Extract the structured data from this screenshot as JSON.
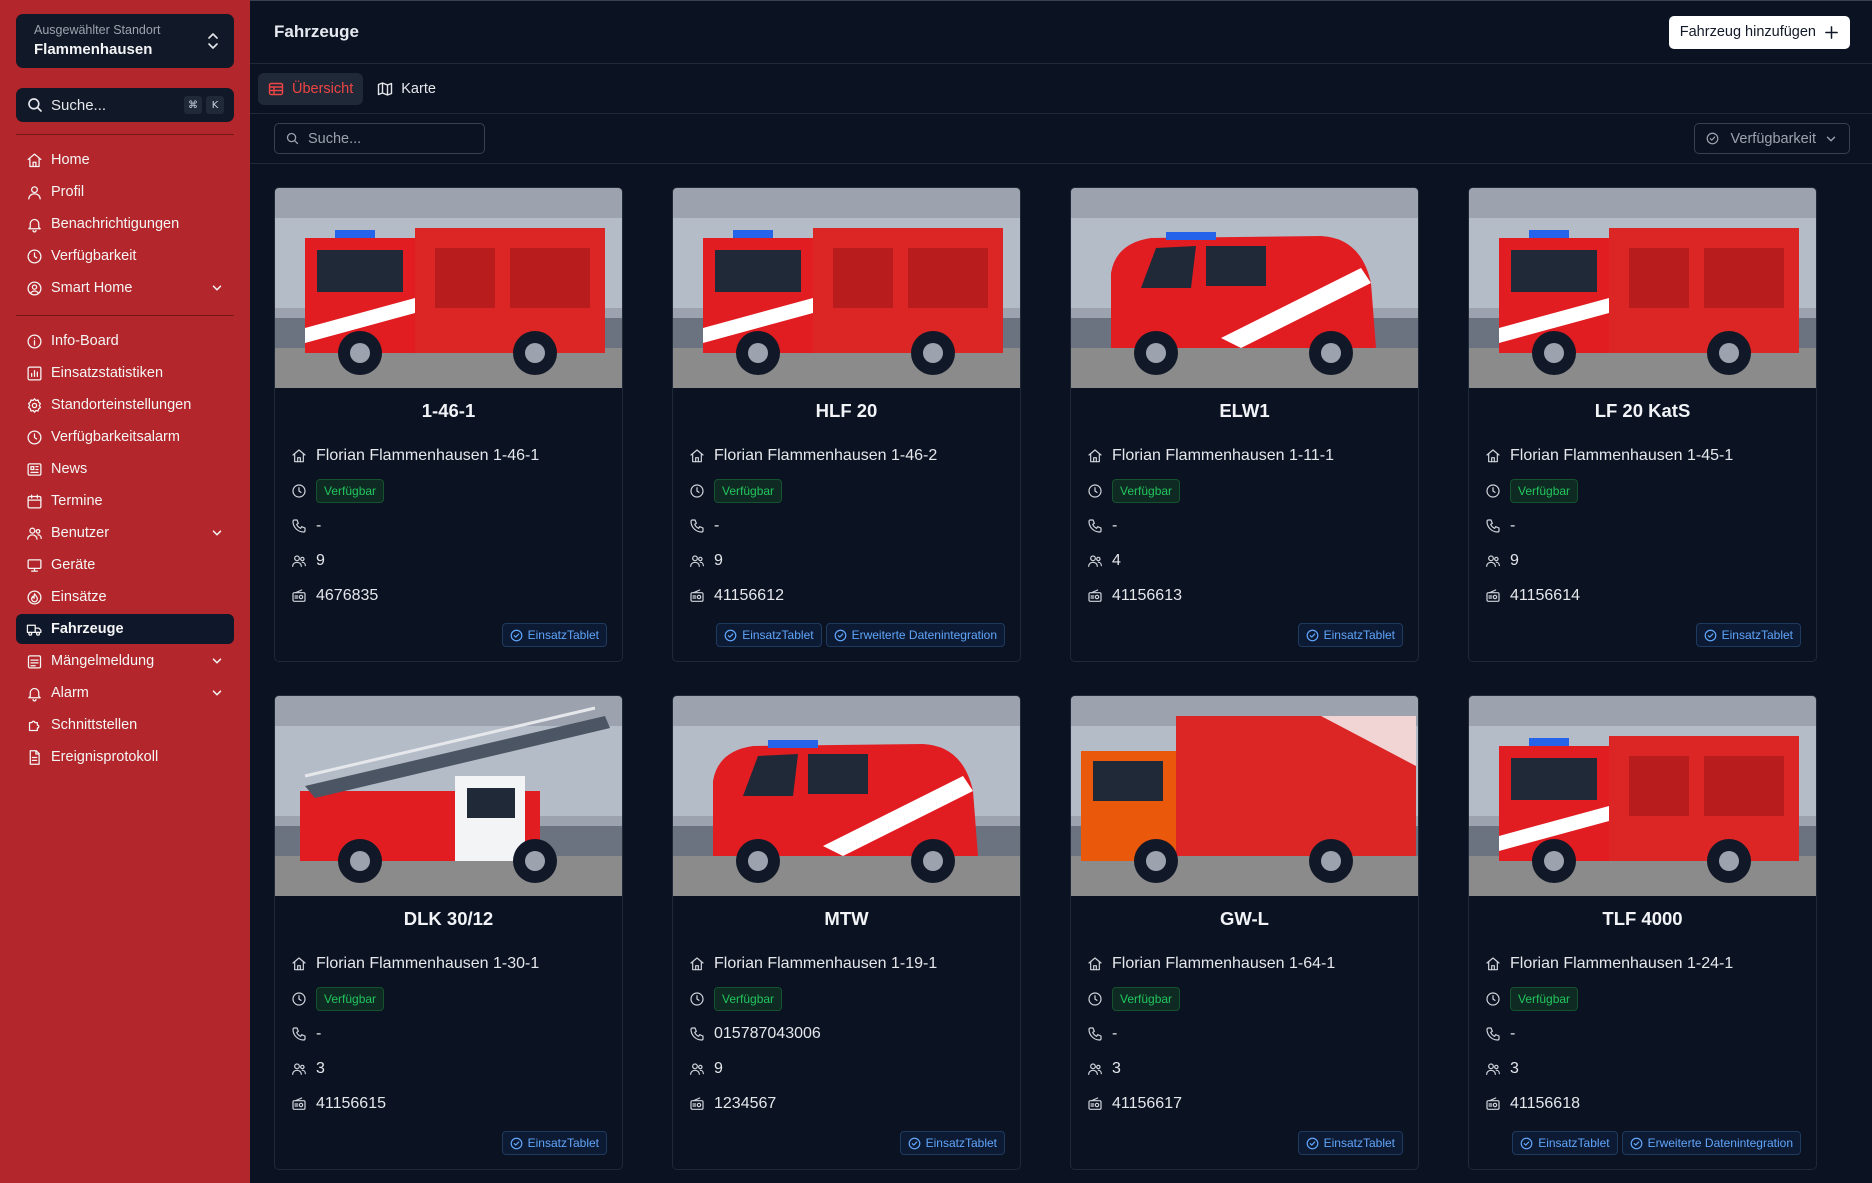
{
  "sidebar": {
    "location_label": "Ausgewählter Standort",
    "location_value": "Flammenhausen",
    "search_placeholder": "Suche...",
    "shortcut_keys": [
      "⌘",
      "K"
    ],
    "items_top": [
      {
        "label": "Home",
        "icon": "home-icon"
      },
      {
        "label": "Profil",
        "icon": "user-icon"
      },
      {
        "label": "Benachrichtigungen",
        "icon": "bell-icon"
      },
      {
        "label": "Verfügbarkeit",
        "icon": "clock-icon"
      },
      {
        "label": "Smart Home",
        "icon": "user-circle-icon",
        "expandable": true
      }
    ],
    "items_bottom": [
      {
        "label": "Info-Board",
        "icon": "info-icon"
      },
      {
        "label": "Einsatzstatistiken",
        "icon": "chart-icon"
      },
      {
        "label": "Standorteinstellungen",
        "icon": "gear-icon"
      },
      {
        "label": "Verfügbarkeitsalarm",
        "icon": "clock-icon"
      },
      {
        "label": "News",
        "icon": "newspaper-icon"
      },
      {
        "label": "Termine",
        "icon": "calendar-icon"
      },
      {
        "label": "Benutzer",
        "icon": "users-icon",
        "expandable": true
      },
      {
        "label": "Geräte",
        "icon": "monitor-icon"
      },
      {
        "label": "Einsätze",
        "icon": "flame-icon"
      },
      {
        "label": "Fahrzeuge",
        "icon": "truck-icon",
        "active": true
      },
      {
        "label": "Mängelmeldung",
        "icon": "clipboard-icon",
        "expandable": true
      },
      {
        "label": "Alarm",
        "icon": "bell-icon",
        "expandable": true
      },
      {
        "label": "Schnittstellen",
        "icon": "puzzle-icon"
      },
      {
        "label": "Ereignisprotokoll",
        "icon": "file-icon"
      }
    ]
  },
  "header": {
    "title": "Fahrzeuge",
    "add_button": "Fahrzeug hinzufügen"
  },
  "tabs": [
    {
      "label": "Übersicht",
      "active": true,
      "icon": "table-icon"
    },
    {
      "label": "Karte",
      "active": false,
      "icon": "map-icon"
    }
  ],
  "filters": {
    "search_placeholder": "Suche...",
    "availability_label": "Verfügbarkeit"
  },
  "colors": {
    "sidebar": "#b3262b",
    "background": "#0b1222",
    "status_green": "#22c55e",
    "badge_blue": "#60a5fa",
    "active_tab": "#ef4444"
  },
  "vehicles": [
    {
      "name": "1-46-1",
      "radio_name": "Florian Flammenhausen 1-46-1",
      "status": "Verfügbar",
      "phone": "-",
      "crew": "9",
      "issi": "4676835",
      "badges": [
        "EinsatzTablet"
      ],
      "style": "box"
    },
    {
      "name": "HLF 20",
      "radio_name": "Florian Flammenhausen 1-46-2",
      "status": "Verfügbar",
      "phone": "-",
      "crew": "9",
      "issi": "41156612",
      "badges": [
        "EinsatzTablet",
        "Erweiterte Datenintegration"
      ],
      "style": "box"
    },
    {
      "name": "ELW1",
      "radio_name": "Florian Flammenhausen 1-11-1",
      "status": "Verfügbar",
      "phone": "-",
      "crew": "4",
      "issi": "41156613",
      "badges": [
        "EinsatzTablet"
      ],
      "style": "van"
    },
    {
      "name": "LF 20 KatS",
      "radio_name": "Florian Flammenhausen 1-45-1",
      "status": "Verfügbar",
      "phone": "-",
      "crew": "9",
      "issi": "41156614",
      "badges": [
        "EinsatzTablet"
      ],
      "style": "box"
    },
    {
      "name": "DLK 30/12",
      "radio_name": "Florian Flammenhausen 1-30-1",
      "status": "Verfügbar",
      "phone": "-",
      "crew": "3",
      "issi": "41156615",
      "badges": [
        "EinsatzTablet"
      ],
      "style": "ladder"
    },
    {
      "name": "MTW",
      "radio_name": "Florian Flammenhausen 1-19-1",
      "status": "Verfügbar",
      "phone": "015787043006",
      "crew": "9",
      "issi": "1234567",
      "badges": [
        "EinsatzTablet"
      ],
      "style": "van"
    },
    {
      "name": "GW-L",
      "radio_name": "Florian Flammenhausen 1-64-1",
      "status": "Verfügbar",
      "phone": "-",
      "crew": "3",
      "issi": "41156617",
      "badges": [
        "EinsatzTablet"
      ],
      "style": "tarp"
    },
    {
      "name": "TLF 4000",
      "radio_name": "Florian Flammenhausen 1-24-1",
      "status": "Verfügbar",
      "phone": "-",
      "crew": "3",
      "issi": "41156618",
      "badges": [
        "EinsatzTablet",
        "Erweiterte Datenintegration"
      ],
      "style": "box"
    }
  ]
}
